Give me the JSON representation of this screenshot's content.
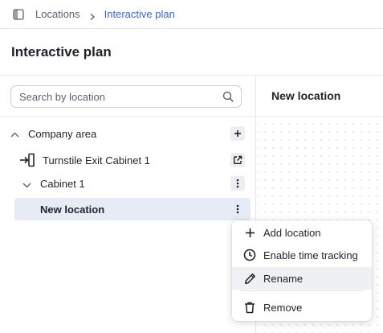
{
  "breadcrumb": {
    "items": [
      "Locations",
      "Interactive plan"
    ]
  },
  "page": {
    "title": "Interactive plan"
  },
  "search": {
    "placeholder": "Search by location",
    "value": ""
  },
  "tree": {
    "company_area": "Company area",
    "turnstile": "Turnstile Exit Cabinet 1",
    "cabinet": "Cabinet 1",
    "new_location": "New location"
  },
  "right_panel": {
    "header": "New location"
  },
  "context_menu": {
    "items": [
      "Add location",
      "Enable time tracking",
      "Rename",
      "Remove"
    ]
  },
  "colors": {
    "accent": "#3b63d6",
    "selected_row": "#e7ebf5",
    "menu_hover": "#eef0f4"
  },
  "icons": {
    "sidebar_toggle": "sidebar-toggle-icon",
    "separator": "chevron-right-icon",
    "search": "search-icon",
    "expand": "chevron-up-icon",
    "collapse": "chevron-down-icon",
    "turnstile": "exit-door-icon",
    "add": "plus-icon",
    "open": "external-link-icon",
    "more": "more-vertical-icon",
    "clock": "clock-icon",
    "pencil": "pencil-icon",
    "trash": "trash-icon"
  }
}
